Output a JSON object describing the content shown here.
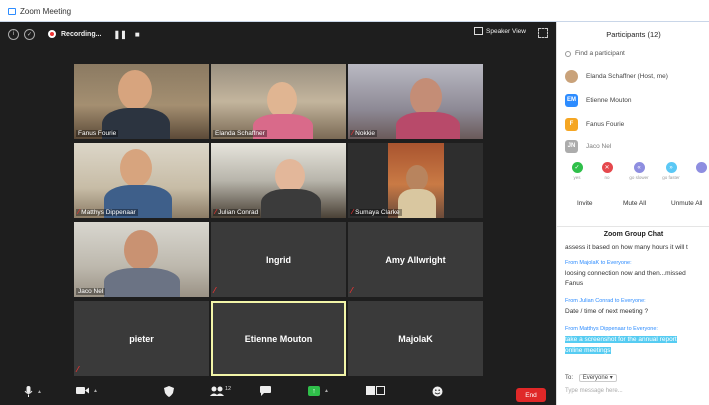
{
  "window": {
    "title": "Zoom Meeting"
  },
  "topbar": {
    "recording_label": "Recording...",
    "pause_glyph": "❚❚",
    "stop_glyph": "■",
    "speaker_view_label": "Speaker View"
  },
  "tiles": [
    {
      "name": "Fanus Fourie",
      "kind": "video",
      "muted": false
    },
    {
      "name": "Elanda Schaffner",
      "kind": "video",
      "muted": false
    },
    {
      "name": "Nokkie",
      "kind": "video",
      "muted": true
    },
    {
      "name": "Matthys Dippenaar",
      "kind": "video",
      "muted": true
    },
    {
      "name": "Julian Conrad",
      "kind": "video",
      "muted": true
    },
    {
      "name": "Sumaya Clarke",
      "kind": "video",
      "muted": true
    },
    {
      "name": "Jaco Nel",
      "kind": "video",
      "muted": false
    },
    {
      "name": "Ingrid",
      "kind": "name",
      "muted": true
    },
    {
      "name": "Amy Allwright",
      "kind": "name",
      "muted": true
    },
    {
      "name": "pieter",
      "kind": "name",
      "muted": true
    },
    {
      "name": "Etienne Mouton",
      "kind": "name",
      "muted": false,
      "active": true
    },
    {
      "name": "MajolaK",
      "kind": "name",
      "muted": false
    }
  ],
  "bottombar": {
    "participants_count": "12",
    "end_label": "End"
  },
  "panel": {
    "title": "Participants (12)",
    "search_placeholder": "Find a participant",
    "participants": [
      {
        "name": "Elanda Schaffner (Host, me)",
        "initials": "",
        "color": "#c9a27a"
      },
      {
        "name": "Etienne Mouton",
        "initials": "EM",
        "color": "#2d8cff"
      },
      {
        "name": "Fanus Fourie",
        "initials": "F",
        "color": "#f5a623"
      },
      {
        "name": "Jaco Nel",
        "initials": "JN",
        "color": "#8a8a8a"
      }
    ],
    "reactions": [
      {
        "label": "yes",
        "color": "#2fbf4a",
        "glyph": "✓"
      },
      {
        "label": "no",
        "color": "#e5484d",
        "glyph": "✕"
      },
      {
        "label": "go slower",
        "color": "#8e8ee0",
        "glyph": "«"
      },
      {
        "label": "go faster",
        "color": "#5bc8f5",
        "glyph": "»"
      },
      {
        "label": "",
        "color": "#8e8ee0",
        "glyph": ""
      }
    ],
    "buttons": {
      "invite": "Invite",
      "mute_all": "Mute All",
      "unmute_all": "Unmute All"
    }
  },
  "chat": {
    "title": "Zoom Group Chat",
    "lines": [
      {
        "type": "text",
        "text": "assess it based on how many hours it will t"
      },
      {
        "type": "from",
        "text": "From MajolaK to Everyone:"
      },
      {
        "type": "text",
        "text": "loosing connection now and then...missed"
      },
      {
        "type": "text",
        "text": "Fanus"
      },
      {
        "type": "from",
        "text": "From Julian Conrad to Everyone:"
      },
      {
        "type": "text",
        "text": "Date / time of next meeting ?"
      },
      {
        "type": "from",
        "text": "From Matthys Dippenaar to Everyone:"
      },
      {
        "type": "hl",
        "text": "take a screenshot for the annual report"
      },
      {
        "type": "hl",
        "text": "online meetings"
      }
    ],
    "to_label": "To:",
    "to_value": "Everyone",
    "input_placeholder": "Type message here..."
  }
}
